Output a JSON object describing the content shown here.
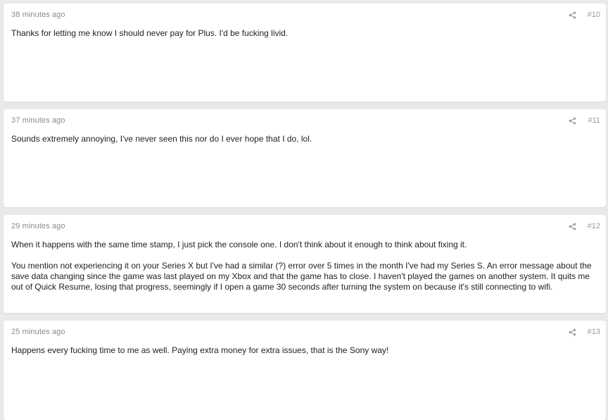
{
  "posts": [
    {
      "time": "38 minutes ago",
      "number": "#10",
      "paragraphs": [
        "Thanks for letting me know I should never pay for Plus. I'd be fucking livid."
      ]
    },
    {
      "time": "37 minutes ago",
      "number": "#11",
      "paragraphs": [
        "Sounds extremely annoying, I've never seen this nor do I ever hope that I do, lol."
      ]
    },
    {
      "time": "29 minutes ago",
      "number": "#12",
      "paragraphs": [
        "When it happens with the same time stamp, I just pick the console one. I don't think about it enough to think about fixing it.",
        "You mention not experiencing it on your Series X but I've had a similar (?) error over 5 times in the month I've had my Series S. An error message about the save data changing since the game was last played on my Xbox and that the game has to close. I haven't played the games on another system. It quits me out of Quick Resume, losing that progress, seemingly if I open a game 30 seconds after turning the system on because it's still connecting to wifi."
      ]
    },
    {
      "time": "25 minutes ago",
      "number": "#13",
      "paragraphs": [
        "Happens every fucking time to me as well. Paying extra money for extra issues, that is the Sony way!"
      ]
    }
  ],
  "icons": {
    "share": "share-icon"
  },
  "colors": {
    "page_background": "#e9e9e9",
    "card_background": "#ffffff",
    "meta_text": "#8a8a8a",
    "body_text": "#222222"
  }
}
